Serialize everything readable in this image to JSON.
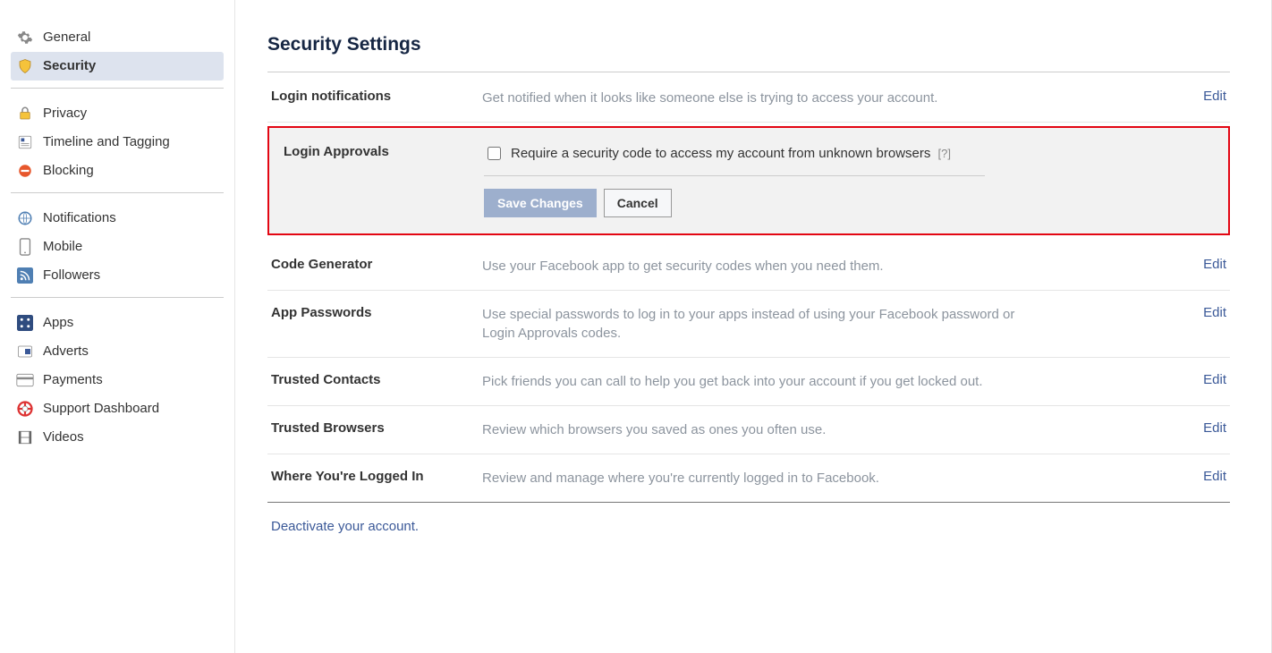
{
  "sidebar": {
    "groups": [
      {
        "items": [
          {
            "key": "general",
            "label": "General",
            "icon": "gear-icon"
          },
          {
            "key": "security",
            "label": "Security",
            "icon": "shield-icon",
            "active": true
          }
        ]
      },
      {
        "items": [
          {
            "key": "privacy",
            "label": "Privacy",
            "icon": "lock-icon"
          },
          {
            "key": "timeline",
            "label": "Timeline and Tagging",
            "icon": "timeline-icon"
          },
          {
            "key": "blocking",
            "label": "Blocking",
            "icon": "block-icon"
          }
        ]
      },
      {
        "items": [
          {
            "key": "notifications",
            "label": "Notifications",
            "icon": "globe-icon"
          },
          {
            "key": "mobile",
            "label": "Mobile",
            "icon": "phone-icon"
          },
          {
            "key": "followers",
            "label": "Followers",
            "icon": "rss-icon"
          }
        ]
      },
      {
        "items": [
          {
            "key": "apps",
            "label": "Apps",
            "icon": "apps-icon"
          },
          {
            "key": "adverts",
            "label": "Adverts",
            "icon": "adverts-icon"
          },
          {
            "key": "payments",
            "label": "Payments",
            "icon": "card-icon"
          },
          {
            "key": "support",
            "label": "Support Dashboard",
            "icon": "lifebuoy-icon"
          },
          {
            "key": "videos",
            "label": "Videos",
            "icon": "film-icon"
          }
        ]
      }
    ]
  },
  "page": {
    "title": "Security Settings",
    "rows": [
      {
        "key": "login-notifications",
        "title": "Login notifications",
        "desc": "Get notified when it looks like someone else is trying to access your account.",
        "edit": "Edit"
      }
    ],
    "login_approvals": {
      "title": "Login Approvals",
      "checkbox_label": "Require a security code to access my account from unknown browsers",
      "help": "[?]",
      "save": "Save Changes",
      "cancel": "Cancel"
    },
    "rows_after": [
      {
        "key": "code-generator",
        "title": "Code Generator",
        "desc": "Use your Facebook app to get security codes when you need them.",
        "edit": "Edit"
      },
      {
        "key": "app-passwords",
        "title": "App Passwords",
        "desc": "Use special passwords to log in to your apps instead of using your Facebook password or Login Approvals codes.",
        "edit": "Edit"
      },
      {
        "key": "trusted-contacts",
        "title": "Trusted Contacts",
        "desc": "Pick friends you can call to help you get back into your account if you get locked out.",
        "edit": "Edit"
      },
      {
        "key": "trusted-browsers",
        "title": "Trusted Browsers",
        "desc": "Review which browsers you saved as ones you often use.",
        "edit": "Edit"
      },
      {
        "key": "where-logged-in",
        "title": "Where You're Logged In",
        "desc": "Review and manage where you're currently logged in to Facebook.",
        "edit": "Edit"
      }
    ],
    "deactivate": "Deactivate your account."
  }
}
